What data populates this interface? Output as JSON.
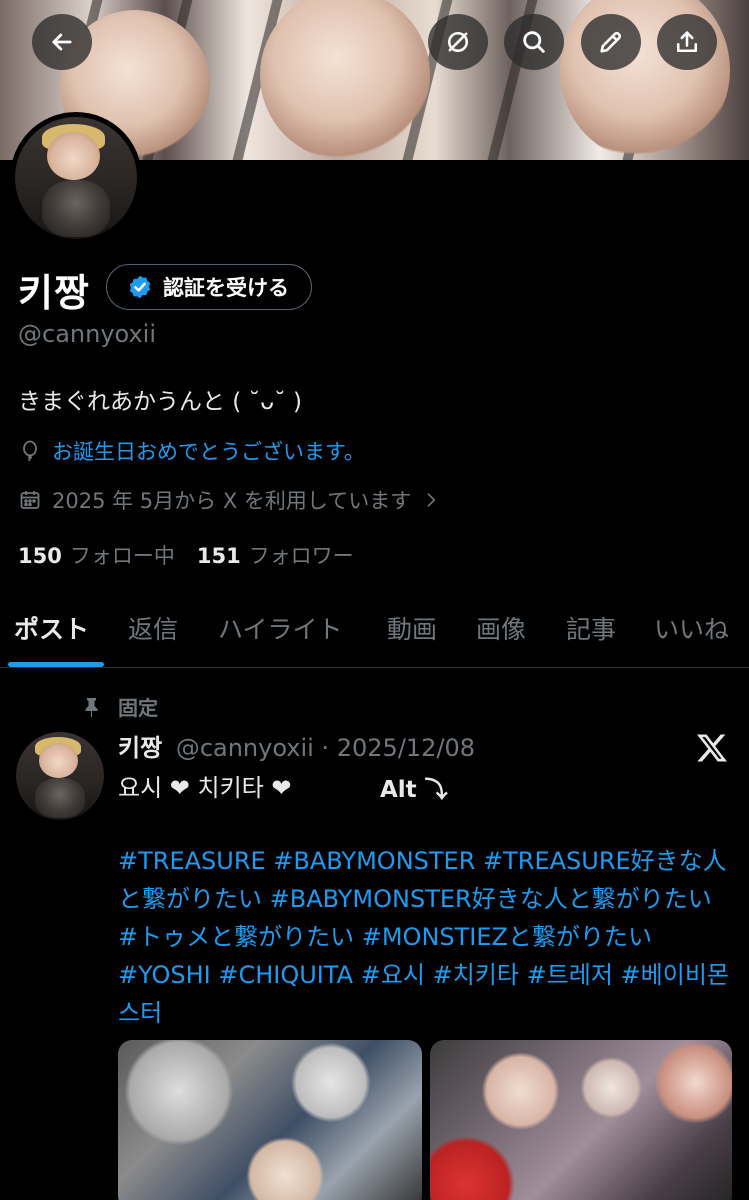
{
  "banner": {
    "description": ""
  },
  "header_actions": {
    "back": "back-arrow-icon",
    "grok": "grok-icon",
    "search": "search-icon",
    "edit": "pencil-icon",
    "share": "share-icon"
  },
  "profile": {
    "name": "키짱",
    "verify_label": "認証を受ける",
    "handle": "@cannyoxii",
    "bio": "きまぐれあかうんと ( ˘ᴗ˘ )",
    "birthday": "お誕生日おめでとうございます。",
    "joined": "2025 年 5月から X を利用しています",
    "following_count": "150",
    "following_label": "フォロー中",
    "followers_count": "151",
    "followers_label": "フォロワー"
  },
  "tabs": [
    "ポスト",
    "返信",
    "ハイライト",
    "動画",
    "画像",
    "記事",
    "いいね"
  ],
  "post": {
    "pinned_label": "固定",
    "author_name": "키짱",
    "author_handle": "@cannyoxii",
    "separator": "·",
    "date": "2025/12/08",
    "line1": "요시 ❤ 치키타 ❤",
    "alt_label": "Alt ⤵",
    "hashtags": "#TREASURE #BABYMONSTER #TREASURE好きな人と繋がりたい #BABYMONSTER好きな人と繋がりたい #トゥメと繋がりたい #MONSTIEZと繋がりたい #YOSHI #CHIQUITA #요시 #치키타 #트레저 #베이비몬스터"
  },
  "colors": {
    "accent": "#1d9bf0",
    "text": "#e7e9ea",
    "muted": "#71767b",
    "background": "#000000"
  }
}
